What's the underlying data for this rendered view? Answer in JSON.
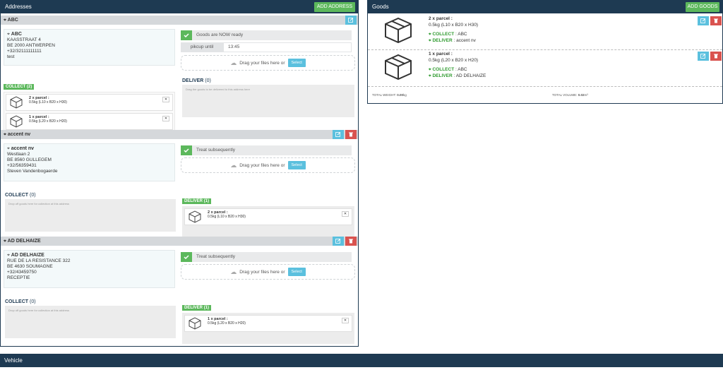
{
  "addresses_panel": {
    "title": "Addresses",
    "add_button": "ADD ADDRESS",
    "common": {
      "drop_text": "Drag your files here or",
      "select_label": "Select"
    },
    "addresses": [
      {
        "name": "ABC",
        "street": "KAASSTRAAT 4",
        "city": "BE 2000 ANTWERPEN",
        "phone": "+32/32111111111",
        "contact": "test",
        "status_text": "Goods are NOW ready",
        "pickup_label": "pikcup until",
        "pickup_value": "13:45",
        "collect_label": "COLLECT",
        "collect_count": "(2)",
        "collect_items": [
          {
            "title": "2 x parcel :",
            "detail": "0.5kg (L10 x B20 x H30)"
          },
          {
            "title": "1 x parcel :",
            "detail": "0.5kg (L20 x B20 x H20)"
          }
        ],
        "deliver_label": "DELIVER",
        "deliver_count": "(0)",
        "deliver_hint": "Drag the goods to be delivered to this address here"
      },
      {
        "name": "accent nv",
        "street": "Westlaan 2",
        "city": "BE 8560 GULLEGEM",
        "phone": "+32/56359431",
        "contact": "Steven Vandenbogaerde",
        "status_text": "Treat subsequently",
        "collect_label": "COLLECT",
        "collect_count": "(0)",
        "collect_hint": "Drop off goods here for collection at this address",
        "deliver_label": "DELIVER",
        "deliver_count": "(1)",
        "deliver_items": [
          {
            "title": "2 x parcel :",
            "detail": "0.5kg (L10 x B20 x H30)"
          }
        ]
      },
      {
        "name": "AD DELHAIZE",
        "street": "RUE DE LA RESISTANCE 322",
        "city": "BE 4630 SOUMAGNE",
        "phone": "+32/43459750",
        "contact": "RECEPTIE",
        "status_text": "Treat subsequently",
        "collect_label": "COLLECT",
        "collect_count": "(0)",
        "collect_hint": "Drop off goods here for collection at this address",
        "deliver_label": "DELIVER",
        "deliver_count": "(1)",
        "deliver_items": [
          {
            "title": "1 x parcel :",
            "detail": "0.5kg (L20 x B20 x H20)"
          }
        ]
      }
    ]
  },
  "goods_panel": {
    "title": "Goods",
    "add_button": "ADD GOODS",
    "collect_label": "COLLECT",
    "deliver_label": "DELIVER",
    "items": [
      {
        "title": "2 x parcel :",
        "detail": "0.5kg (L10 x B20 x H30)",
        "collect": ": ABC",
        "deliver": ": accent nv"
      },
      {
        "title": "1 x parcel :",
        "detail": "0.5kg (L20 x B20 x H20)",
        "collect": ": ABC",
        "deliver": ": AD DELHAIZE"
      }
    ],
    "total_weight_label": "TOTAL WEIGHT:",
    "total_weight_value": "0.00",
    "total_weight_unit": "kg",
    "total_volume_label": "TOTAL VOLUME:",
    "total_volume_value": "0.02",
    "total_volume_unit": "m³"
  },
  "vehicle_panel": {
    "title": "Vehicle"
  },
  "colors": {
    "navy": "#1e3a52",
    "green": "#5cb85c",
    "blue": "#5bc0de",
    "red": "#d9534f"
  }
}
